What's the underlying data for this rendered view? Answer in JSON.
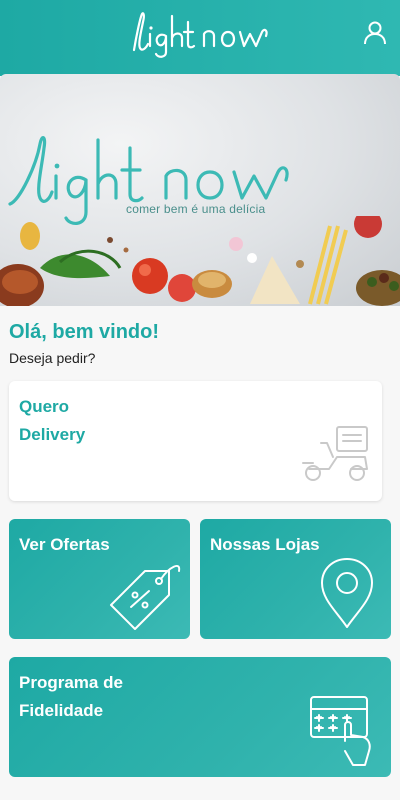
{
  "app": {
    "brand": "light now",
    "tagline": "comer bem é uma delícia",
    "accent_color": "#1ea9a4",
    "icons": {
      "account": "user-icon"
    }
  },
  "home": {
    "greeting": "Olá, bem vindo!",
    "subtitle": "Deseja pedir?"
  },
  "cards": {
    "delivery": {
      "line1": "Quero",
      "line2": "Delivery",
      "icon": "delivery-scooter-icon"
    },
    "ofertas": {
      "label": "Ver Ofertas",
      "icon": "discount-tag-icon"
    },
    "lojas": {
      "label": "Nossas Lojas",
      "icon": "location-pin-icon"
    },
    "fidelidade": {
      "line1": "Programa de",
      "line2": "Fidelidade",
      "icon": "loyalty-card-icon"
    }
  }
}
